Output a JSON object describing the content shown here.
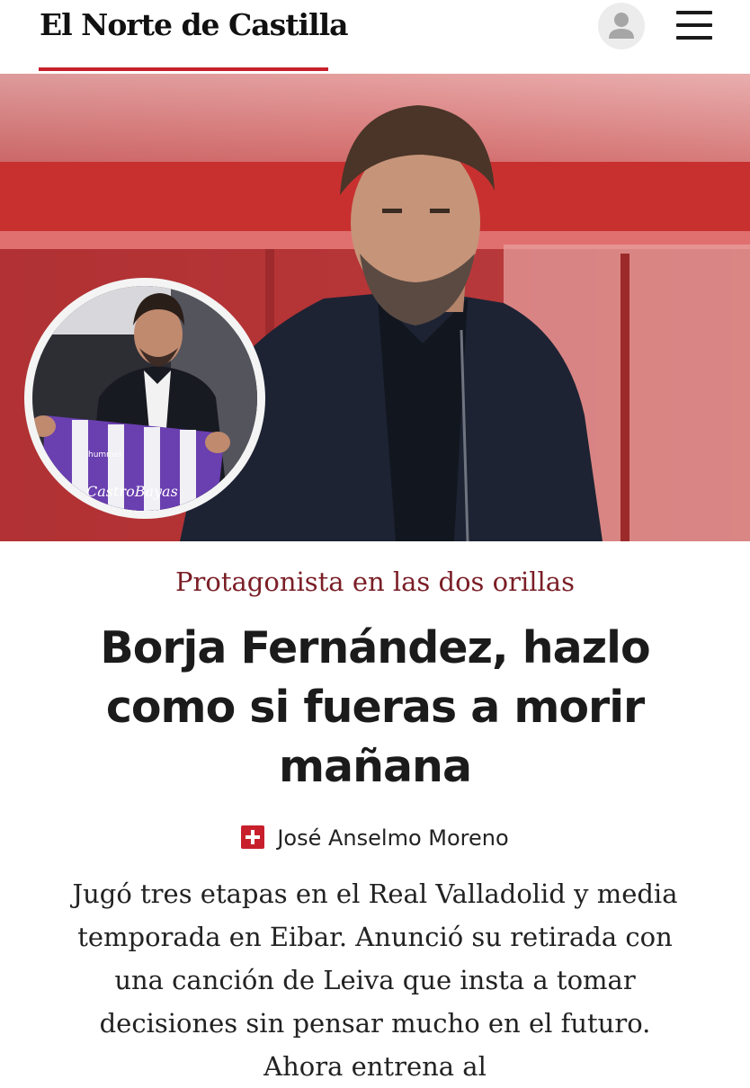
{
  "header": {
    "logo_text": "El Norte de Castilla",
    "account_icon": "user-avatar-icon",
    "menu_icon": "hamburger-menu-icon",
    "accent_color": "#c7202c"
  },
  "hero": {
    "inset_shirt_text": "CastroBayas",
    "inset_shirt_brand": "hummel"
  },
  "article": {
    "kicker": "Protagonista en las dos orillas",
    "headline": "Borja Fernández, hazlo como si fueras a morir mañana",
    "author_icon": "plus-icon",
    "author": "José Anselmo Moreno",
    "lead": "Jugó tres etapas en el Real Valladolid y media temporada en Eibar. Anunció su retirada con una canción de Leiva que insta a tomar decisiones sin pensar mucho en el futuro. Ahora entrena al"
  }
}
